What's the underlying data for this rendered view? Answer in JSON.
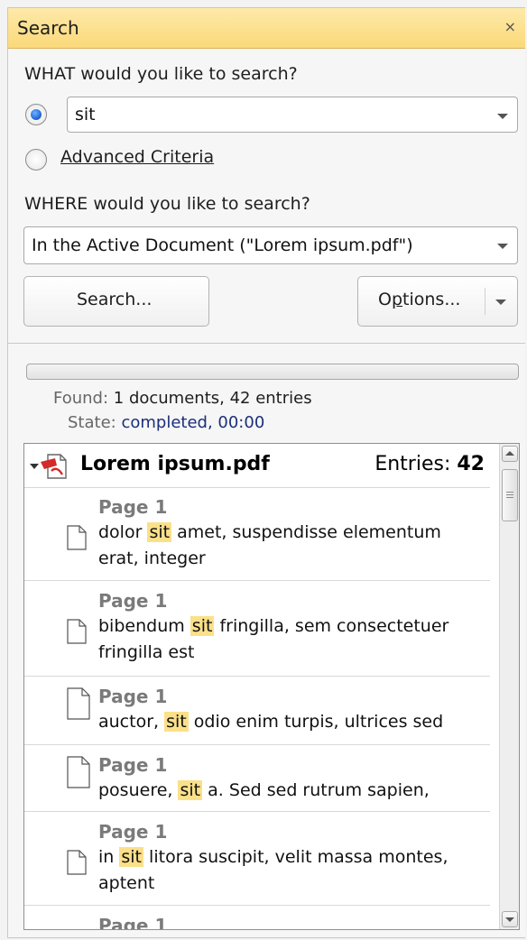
{
  "panel": {
    "title": "Search",
    "close_glyph": "×"
  },
  "what": {
    "label": "WHAT would you like to search?",
    "query": "sit",
    "advanced_label": "Advanced Criteria",
    "selected_mode": "query"
  },
  "where": {
    "label": "WHERE would you like to search?",
    "scope": "In the Active Document (\"Lorem ipsum.pdf\")"
  },
  "buttons": {
    "search": "Search...",
    "options_pre": "O",
    "options_mnemonic": "p",
    "options_post": "tions..."
  },
  "status": {
    "found_key": "Found:",
    "found_val": "1 documents, 42 entries",
    "state_key": "State:",
    "state_val": "completed, 00:00",
    "progress": 0
  },
  "results": {
    "doc_name": "Lorem ipsum.pdf",
    "entries_label": "Entries:",
    "entries_count": "42",
    "items": [
      {
        "page": "Page 1",
        "before": "dolor ",
        "hit": "sit",
        "after": " amet,  suspendisse elementum  erat,  integer"
      },
      {
        "page": "Page 1",
        "before": "bibendum ",
        "hit": "sit",
        "after": " fringilla,  sem consectetuer  fringilla  est"
      },
      {
        "page": "Page 1",
        "before": "auctor, ",
        "hit": "sit",
        "after": " odio enim turpis, ultrices sed"
      },
      {
        "page": "Page 1",
        "before": "posuere,  ",
        "hit": "sit",
        "after": "  a.  Sed  sed  rutrum  sapien,"
      },
      {
        "page": "Page 1",
        "before": "in ",
        "hit": "sit",
        "after": " litora suscipit, velit massa montes, aptent"
      },
      {
        "page": "Page 1",
        "before": "",
        "hit": "",
        "after": ""
      }
    ]
  },
  "icons": {
    "close": "close-icon",
    "pdf": "pdf-document-icon",
    "page": "page-icon",
    "expand": "expand-triangle-icon",
    "dropdown": "chevron-down-icon"
  }
}
